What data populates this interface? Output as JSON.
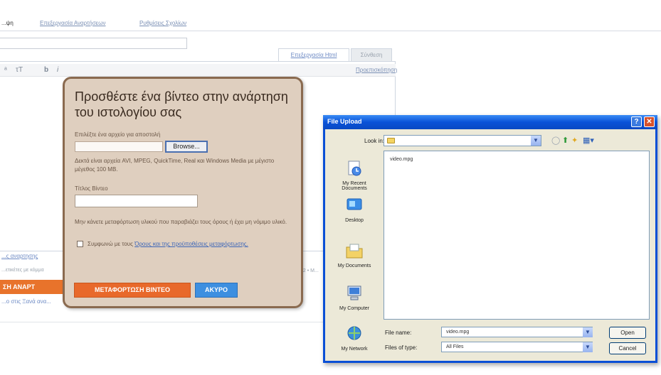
{
  "page": {
    "top_tabs": [
      "...ψη",
      "Επεξεργασία Αναρτήσεων",
      "Ρυθμίσεις Σχολίων"
    ],
    "editor_tabs": {
      "html": "Επεξεργασία Html",
      "compose": "Σύνθεση"
    },
    "preview": "Προεπισκόπηση",
    "left_link": "...ς αναρτησης",
    "left_small": "...ετικέτες με κόμμα",
    "left_button": "ΣΗ ΑΝΑΡΤ",
    "left_bottom_link": "...ο στις Ξανά ανα...",
    "right_fragment": ", 2 • Μ..."
  },
  "video_dialog": {
    "title": "Προσθέστε ένα βίντεο στην ανάρτηση του ιστολογίου σας",
    "choose_file_label": "Επιλέξτε ένα αρχείο για αποστολή",
    "browse": "Browse...",
    "formats_note": "Δεκτά είναι αρχεία AVI, MPEG, QuickTime, Real και Windows Media με μέγιστο μέγεθος 100 MB.",
    "video_title_label": "Τίτλος Βίντεο",
    "video_title_value": "",
    "rights_note": "Μην κάνετε μεταφόρτωση υλικού που παραβιάζει τους όρους ή έχει μη νόμιμο υλικό.",
    "agree_prefix": "Συμφωνώ με τους ",
    "terms_link": "Όρους και της προϋποθέσεις μεταφόρτωσης.",
    "upload_button": "ΜΕΤΑΦΟΡΤΩΣΗ ΒΙΝΤΕΟ",
    "cancel_button": "ΑΚΥΡΟ",
    "colors": {
      "panel": "#dfcfbf",
      "border": "#8a6a4f",
      "upload": "#e8692b",
      "cancel": "#3d8fe0"
    }
  },
  "file_dialog": {
    "title": "File Upload",
    "help_icon": "?",
    "close_icon": "✕",
    "look_in_label": "Look in:",
    "look_in_value": "",
    "places": [
      "My Recent Documents",
      "Desktop",
      "My Documents",
      "My Computer",
      "My Network"
    ],
    "files": [
      "video.mpg"
    ],
    "file_name_label": "File name:",
    "file_name_value": "video.mpg",
    "file_type_label": "Files of type:",
    "file_type_value": "All Files",
    "open_button": "Open",
    "cancel_button": "Cancel",
    "colors": {
      "titlebar": "#0a52d8",
      "body": "#ece9d8"
    }
  }
}
